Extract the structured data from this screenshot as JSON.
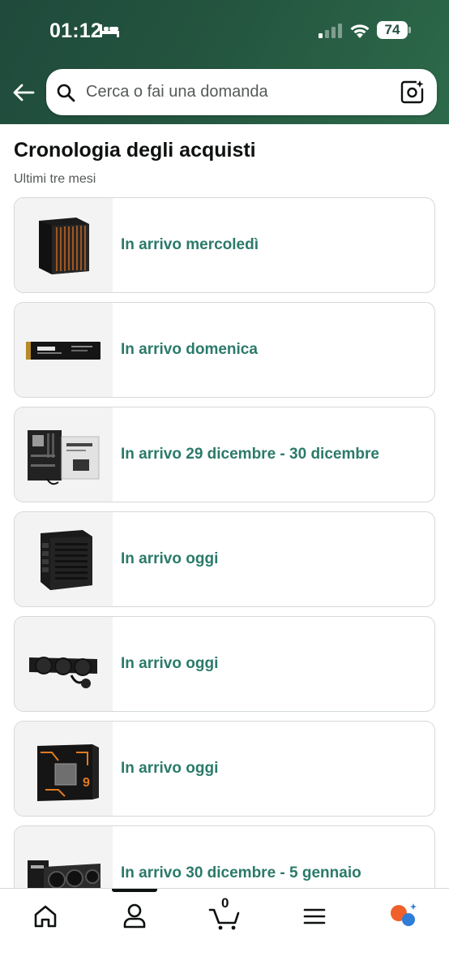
{
  "status_bar": {
    "time": "01:12",
    "battery": "74"
  },
  "search": {
    "placeholder": "Cerca o fai una domanda"
  },
  "page": {
    "title": "Cronologia degli acquisti",
    "subtitle": "Ultimi tre mesi"
  },
  "orders": [
    {
      "status": "In arrivo mercoledì",
      "product_icon": "pc-case-icon"
    },
    {
      "status": "In arrivo domenica",
      "product_icon": "ssd-icon"
    },
    {
      "status": "In arrivo 29 dicembre - 30 dicembre",
      "product_icon": "motherboard-icon"
    },
    {
      "status": "In arrivo oggi",
      "product_icon": "power-supply-icon"
    },
    {
      "status": "In arrivo oggi",
      "product_icon": "liquid-cooler-icon"
    },
    {
      "status": "In arrivo oggi",
      "product_icon": "cpu-box-icon"
    },
    {
      "status": "In arrivo 30 dicembre - 5 gennaio",
      "product_icon": "graphics-card-icon"
    }
  ],
  "nav": {
    "items": [
      "home-icon",
      "account-icon",
      "cart-icon",
      "menu-icon",
      "assistant-icon"
    ],
    "cart_count": "0"
  },
  "colors": {
    "header": "#24553f",
    "status_text": "#2b7a6a",
    "card_border": "#d5d9d9",
    "thumb_bg": "#f3f3f3"
  }
}
